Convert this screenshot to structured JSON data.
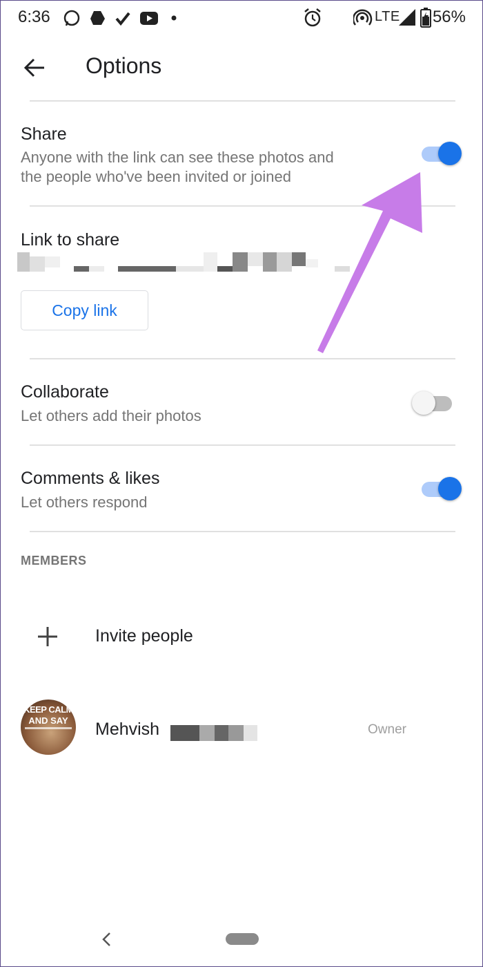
{
  "status_bar": {
    "time": "6:36",
    "network": "LTE",
    "battery": "56%",
    "icons": [
      "whatsapp-icon",
      "drive-icon",
      "check-icon",
      "youtube-icon",
      "dot-icon",
      "alarm-icon",
      "hotspot-icon",
      "signal-icon",
      "battery-icon"
    ]
  },
  "app_bar": {
    "title": "Options",
    "back_icon": "arrow-back-icon"
  },
  "share": {
    "title": "Share",
    "subtitle_line1": "Anyone with the link can see these photos and",
    "subtitle_line2": "the people who've been invited or joined",
    "enabled": true
  },
  "link": {
    "title": "Link to share",
    "copy_label": "Copy link"
  },
  "collaborate": {
    "title": "Collaborate",
    "subtitle": "Let others add their photos",
    "enabled": false
  },
  "comments": {
    "title": "Comments & likes",
    "subtitle": "Let others respond",
    "enabled": true
  },
  "members": {
    "section_label": "MEMBERS",
    "invite_label": "Invite people",
    "member_name": "Mehvish",
    "member_role": "Owner",
    "avatar_text_line1": "KEEP CALM",
    "avatar_text_line2": "AND SAY"
  },
  "colors": {
    "accent": "#1a73e8",
    "annotation_arrow": "#c77ce8"
  }
}
